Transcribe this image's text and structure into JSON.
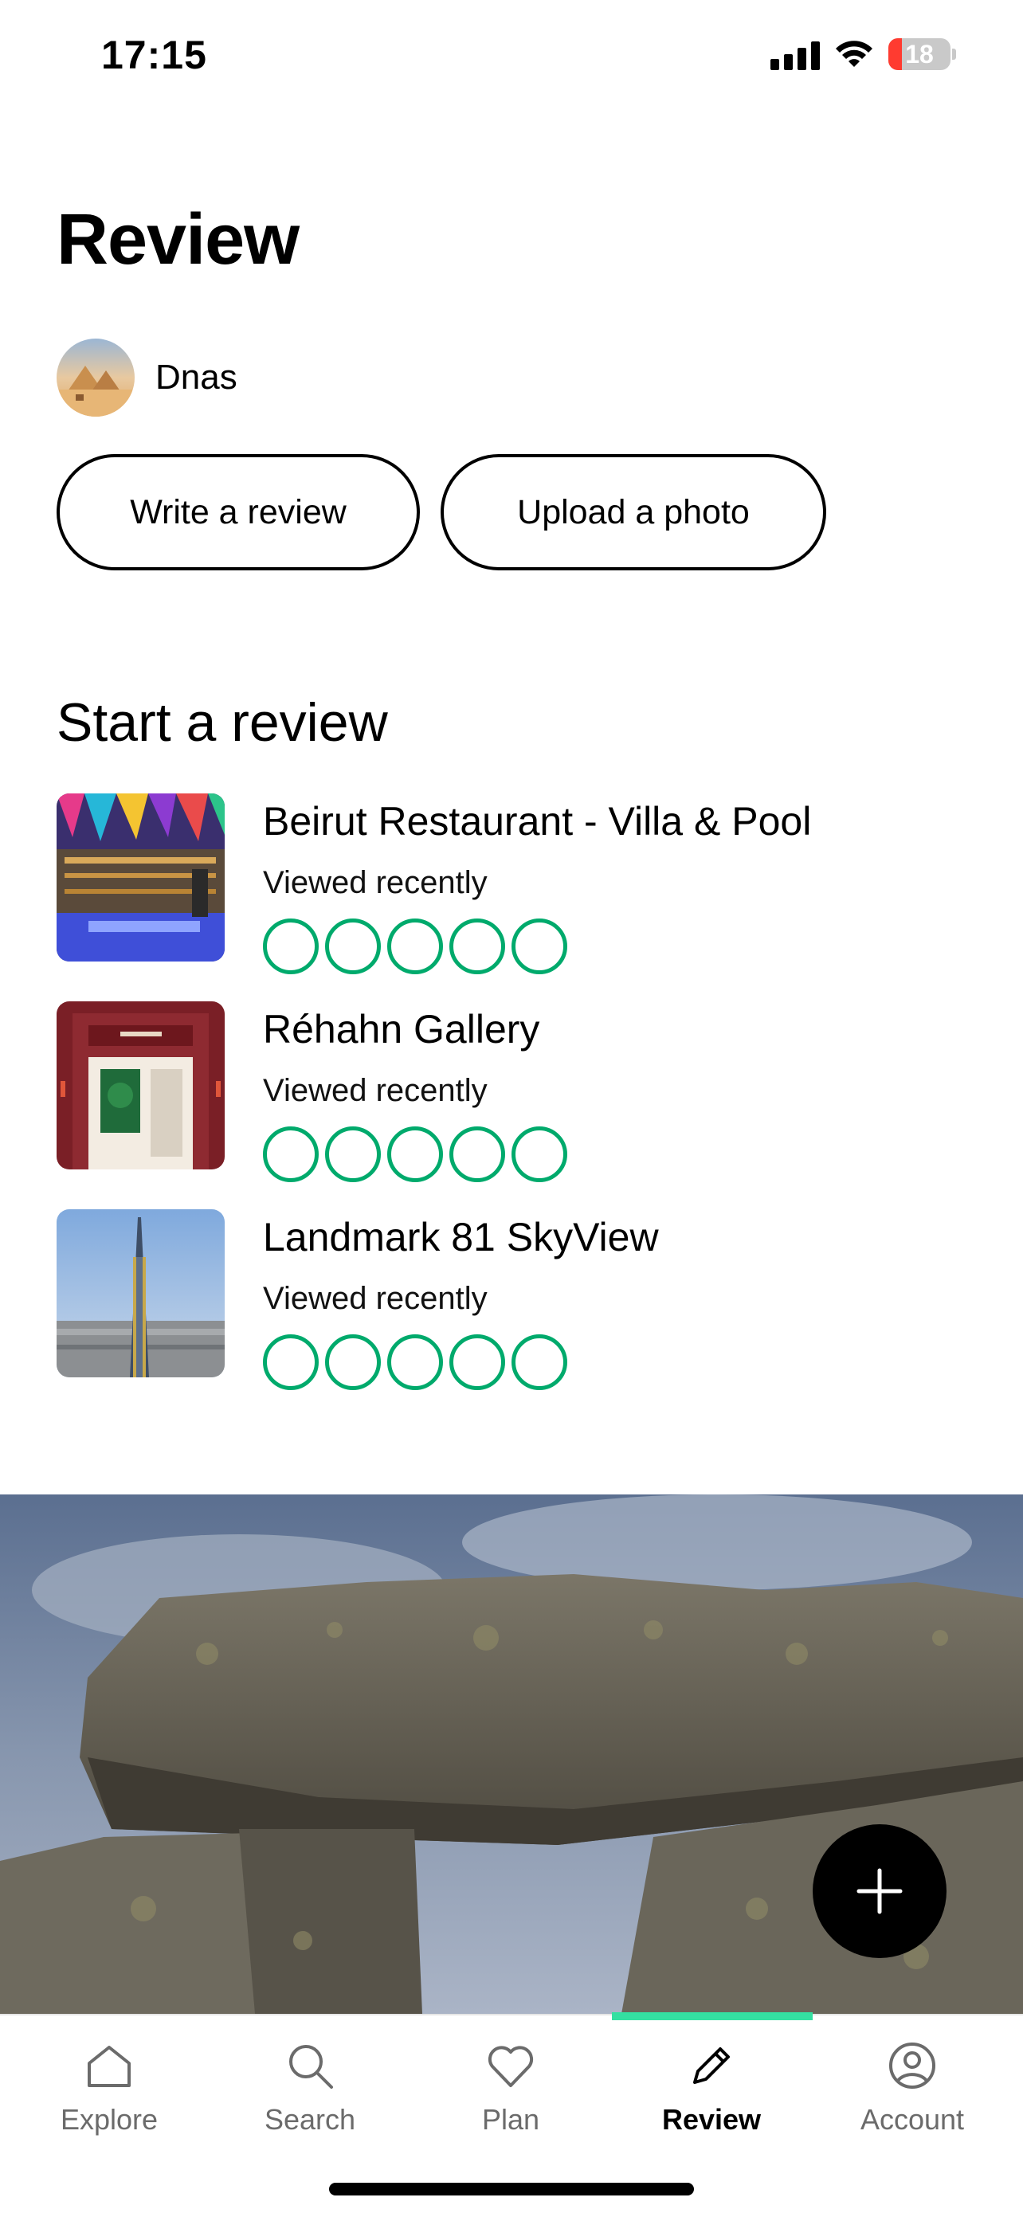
{
  "status_bar": {
    "time": "17:15",
    "battery": "18"
  },
  "header": {
    "title": "Review"
  },
  "user": {
    "name": "Dnas"
  },
  "actions": {
    "write_label": "Write a review",
    "upload_label": "Upload a photo"
  },
  "start_section": {
    "title": "Start a review",
    "items": [
      {
        "title": "Beirut Restaurant - Villa & Pool",
        "subtitle": "Viewed recently",
        "rating_bubbles": 5,
        "rating_filled": 0
      },
      {
        "title": "Réhahn Gallery",
        "subtitle": "Viewed recently",
        "rating_bubbles": 5,
        "rating_filled": 0
      },
      {
        "title": "Landmark 81 SkyView",
        "subtitle": "Viewed recently",
        "rating_bubbles": 5,
        "rating_filled": 0
      }
    ]
  },
  "fab": {
    "icon": "plus-icon"
  },
  "tabs": [
    {
      "label": "Explore",
      "icon": "home-icon",
      "active": false
    },
    {
      "label": "Search",
      "icon": "search-icon",
      "active": false
    },
    {
      "label": "Plan",
      "icon": "heart-icon",
      "active": false
    },
    {
      "label": "Review",
      "icon": "pencil-icon",
      "active": true
    },
    {
      "label": "Account",
      "icon": "account-icon",
      "active": false
    }
  ],
  "colors": {
    "accent_green": "#00aa6c",
    "tab_indicator": "#34e0a1",
    "battery_low": "#ff3b30"
  }
}
